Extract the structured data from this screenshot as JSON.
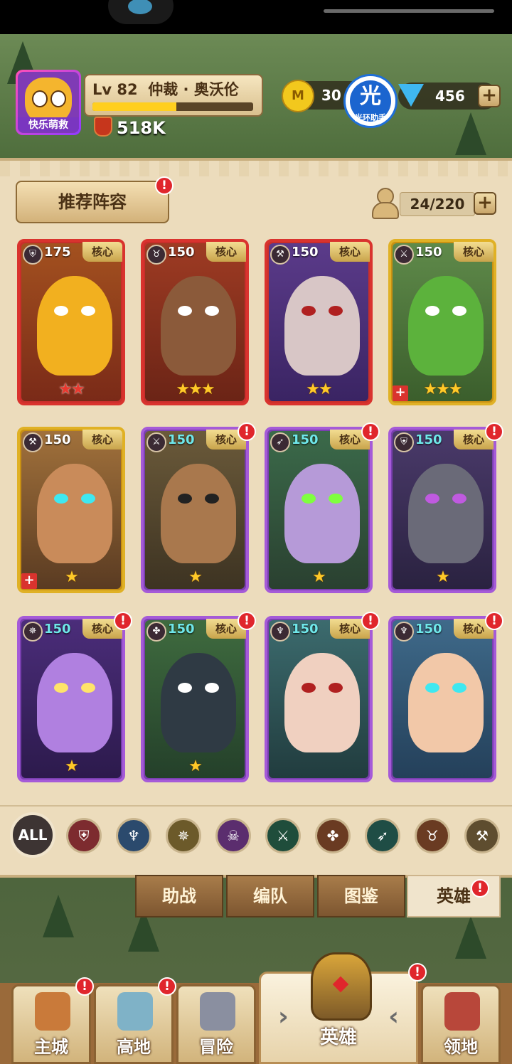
{
  "player": {
    "level": "Lv 82",
    "name": "仲裁 · 奥沃伦",
    "avatar_label": "快乐萌救",
    "xp_fraction": 0.52,
    "power": "518K"
  },
  "currency": {
    "gold": "30",
    "gem": "456",
    "helper_icon_text": "光",
    "helper_label": "光环助手"
  },
  "panel": {
    "recommend_button": "推荐阵容",
    "capacity": "24/220"
  },
  "heroes": [
    {
      "level": "175",
      "core": "核心",
      "stars": "★★",
      "star_color": "red",
      "class_icon": "shield",
      "badge": false,
      "plus": false
    },
    {
      "level": "150",
      "core": "核心",
      "stars": "★★★",
      "star_color": "gold",
      "class_icon": "horned-skull",
      "badge": false,
      "plus": false
    },
    {
      "level": "150",
      "core": "核心",
      "stars": "★★",
      "star_color": "gold",
      "class_icon": "axe",
      "badge": false,
      "plus": false
    },
    {
      "level": "150",
      "core": "核心",
      "stars": "★★★",
      "star_color": "gold",
      "class_icon": "crossed-swords",
      "badge": false,
      "plus": true
    },
    {
      "level": "150",
      "core": "核心",
      "stars": "★",
      "star_color": "gold",
      "class_icon": "axe",
      "badge": false,
      "plus": true
    },
    {
      "level": "150",
      "core": "核心",
      "stars": "★",
      "star_color": "gold",
      "class_icon": "crossed-swords",
      "badge": true,
      "plus": false
    },
    {
      "level": "150",
      "core": "核心",
      "stars": "★",
      "star_color": "gold",
      "class_icon": "bow",
      "badge": true,
      "plus": false
    },
    {
      "level": "150",
      "core": "核心",
      "stars": "★",
      "star_color": "gold",
      "class_icon": "shield",
      "badge": true,
      "plus": false
    },
    {
      "level": "150",
      "core": "核心",
      "stars": "★",
      "star_color": "gold",
      "class_icon": "winged-emblem",
      "badge": true,
      "plus": false
    },
    {
      "level": "150",
      "core": "核心",
      "stars": "★",
      "star_color": "gold",
      "class_icon": "paw",
      "badge": true,
      "plus": false
    },
    {
      "level": "150",
      "core": "核心",
      "stars": "",
      "star_color": "gold",
      "class_icon": "staff",
      "badge": true,
      "plus": false
    },
    {
      "level": "150",
      "core": "核心",
      "stars": "",
      "star_color": "gold",
      "class_icon": "staff",
      "badge": true,
      "plus": false
    }
  ],
  "filters": {
    "all_label": "ALL",
    "icons": [
      "shield-icon",
      "staff-icon",
      "winged-emblem-icon",
      "skull-icon",
      "crossed-swords-icon",
      "paw-icon",
      "bow-icon",
      "horned-skull-icon",
      "axe-icon"
    ]
  },
  "tabs": [
    "助战",
    "编队",
    "图鉴",
    "英雄"
  ],
  "active_tab": "英雄",
  "nav": {
    "main_city": "主城",
    "highland": "高地",
    "adventure": "冒险",
    "heroes": "英雄",
    "territory": "领地"
  },
  "badge_symbol": "!",
  "colors": {
    "card_red": "#d9332e",
    "card_purple": "#a55ad8",
    "card_gold": "#e0b125",
    "badge": "#e0262c",
    "level_teal": "#6fe7ea"
  }
}
